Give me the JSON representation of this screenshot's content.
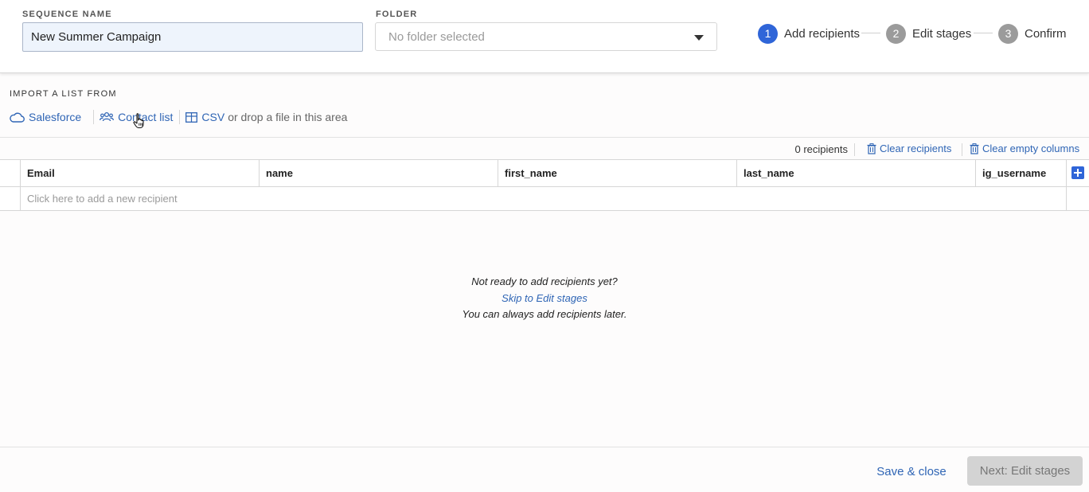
{
  "header": {
    "sequence_name_label": "SEQUENCE NAME",
    "sequence_name_value": "New Summer Campaign",
    "folder_label": "FOLDER",
    "folder_placeholder": "No folder selected",
    "steps": [
      {
        "number": "1",
        "label": "Add recipients",
        "active": true
      },
      {
        "number": "2",
        "label": "Edit stages",
        "active": false
      },
      {
        "number": "3",
        "label": "Confirm",
        "active": false
      }
    ]
  },
  "import": {
    "label": "IMPORT A LIST FROM",
    "salesforce": "Salesforce",
    "contact_list": "Contact list",
    "csv": "CSV",
    "drop_text": "or drop a file in this area"
  },
  "toolbar": {
    "count": "0 recipients",
    "clear_recipients": "Clear recipients",
    "clear_empty_columns": "Clear empty columns"
  },
  "table": {
    "columns": [
      "Email",
      "name",
      "first_name",
      "last_name",
      "ig_username"
    ],
    "add_row_placeholder": "Click here to add a new recipient"
  },
  "empty_state": {
    "line1": "Not ready to add recipients yet?",
    "link": "Skip to Edit stages",
    "line2": "You can always add recipients later."
  },
  "footer": {
    "save_label": "Save & close",
    "next_label": "Next: Edit stages"
  },
  "colors": {
    "accent": "#2f65d8",
    "link": "#2f65b5",
    "inactive_step": "#9b9b9b"
  }
}
